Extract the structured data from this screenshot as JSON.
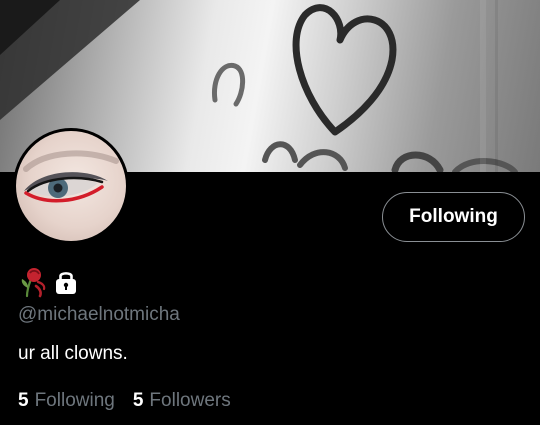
{
  "profile": {
    "banner_image": "foggy-window-heart-drawing",
    "avatar_image": "eye-closeup-red-eyeliner",
    "name_emojis": [
      "wilted-rose-icon",
      "lock-icon"
    ],
    "handle": "@michaelnotmicha",
    "bio": "ur all clowns.",
    "follow_button_label": "Following",
    "stats": {
      "following_count": "5",
      "following_label": "Following",
      "followers_count": "5",
      "followers_label": "Followers"
    }
  },
  "colors": {
    "background": "#000000",
    "text": "#ffffff",
    "secondary_text": "#6e767d",
    "button_border": "#8a8f94"
  }
}
